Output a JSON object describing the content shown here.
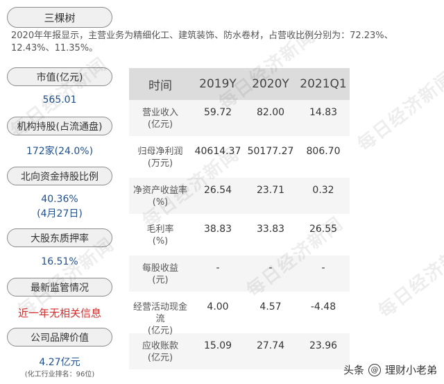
{
  "title": "三棵树",
  "description": "2020年年报显示，主营业务为精细化工、建筑装饰、防水卷材，占营收比例分别为：72.23%、12.43%、11.35%。",
  "sidebar": {
    "market_value": {
      "label": "市值(亿元)",
      "value": "565.01"
    },
    "institution": {
      "label": "机构持股(占流通盘)",
      "value": "172家(24.0%)"
    },
    "northbound": {
      "label": "北向资金持股比例",
      "value": "40.36%",
      "sub": "(4月27日)"
    },
    "pledge": {
      "label": "大股东质押率",
      "value": "16.51%"
    },
    "regulation": {
      "label": "最新监管情况",
      "value": "近一年无相关信息"
    },
    "brand_value": {
      "label": "公司品牌价值",
      "value": "4.27亿元",
      "sub": "(化工行业排名：96位)"
    }
  },
  "table": {
    "headers": [
      "时间",
      "2019Y",
      "2020Y",
      "2021Q1"
    ],
    "rows": [
      {
        "label": "营业收入\n(亿元)",
        "values": [
          "59.72",
          "82.00",
          "14.83"
        ]
      },
      {
        "label": "归母净利润\n(万元)",
        "values": [
          "40614.37",
          "50177.27",
          "806.70"
        ]
      },
      {
        "label": "净资产收益率\n(%)",
        "values": [
          "26.54",
          "23.71",
          "0.32"
        ]
      },
      {
        "label": "毛利率\n(%)",
        "values": [
          "38.83",
          "33.83",
          "26.55"
        ]
      },
      {
        "label": "每股收益\n(元)",
        "values": [
          "-",
          "-",
          "-"
        ]
      },
      {
        "label": "经营活动现金流\n(亿元)",
        "values": [
          "4.00",
          "4.57",
          "-4.48"
        ]
      },
      {
        "label": "应收账款\n(亿元)",
        "values": [
          "15.09",
          "27.74",
          "23.96"
        ]
      }
    ]
  },
  "watermark_text": "每日经济新闻",
  "brand": {
    "prefix": "头条",
    "at": "@",
    "name": "理财小老弟"
  }
}
